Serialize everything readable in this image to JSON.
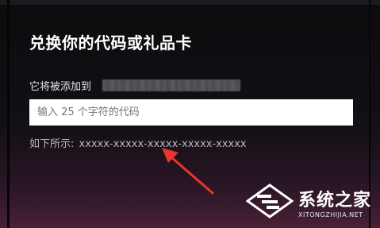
{
  "dialog": {
    "title": "兑换你的代码或礼品卡",
    "add_to_label": "它将被添加到",
    "code_input": {
      "placeholder": "输入 25 个字符的代码",
      "value": ""
    },
    "example_label": "如下所示:",
    "example_code": "xxxxx-xxxxx-xxxxx-xxxxx-xxxxx"
  },
  "annotation": {
    "arrow_color": "#e8362c"
  },
  "watermark": {
    "brand": "系统之家",
    "url": "XITONGZHIJIA.NET"
  },
  "colors": {
    "background": "#121015",
    "input_background": "#ffffff",
    "text": "#ffffff",
    "muted_text": "#b9b9b9"
  }
}
